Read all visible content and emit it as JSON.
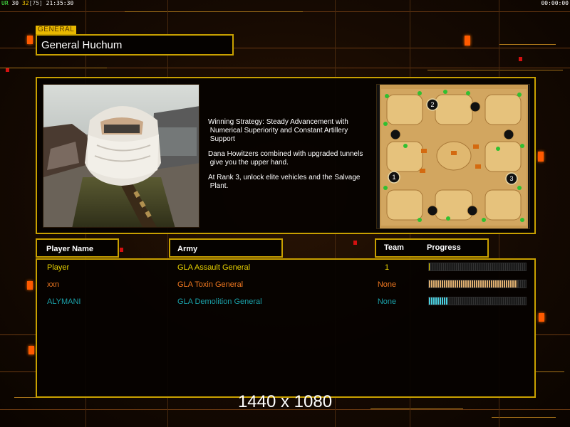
{
  "status": {
    "label": "UR",
    "val1": "30",
    "val2": "32",
    "val3": "[75]",
    "time": "21:35:30"
  },
  "clock": "00:00:00",
  "general": {
    "tag": "GENERAL",
    "name": "General Huchum",
    "strategy": [
      "Winning Strategy: Steady Advancement with\n Numerical Superiority and Constant Artillery\n Support",
      "Dana Howitzers combined with upgraded tunnels\n give you the upper hand.",
      "At Rank 3, unlock elite vehicles and the Salvage\n Plant."
    ]
  },
  "map": {
    "start_positions": [
      "1",
      "2",
      "3"
    ]
  },
  "headers": {
    "player": "Player Name",
    "army": "Army",
    "team": "Team",
    "progress": "Progress"
  },
  "players": [
    {
      "name": "Player",
      "army": "GLA Assault General",
      "team": "1",
      "progress": 0.01,
      "color": "#e8d200",
      "bar_color": "#e8d200"
    },
    {
      "name": "xxn",
      "army": "GLA Toxin General",
      "team": "None",
      "progress": 0.91,
      "color": "#f07820",
      "bar_color": "#e0b070"
    },
    {
      "name": "ALYMANI",
      "army": "GLA Demolition General",
      "team": "None",
      "progress": 0.2,
      "color": "#1aa0a8",
      "bar_color": "#4ad0e0"
    }
  ],
  "resolution": "1440 x 1080",
  "colors": {
    "frame": "#c8a000",
    "accent": "#ff5a00"
  }
}
